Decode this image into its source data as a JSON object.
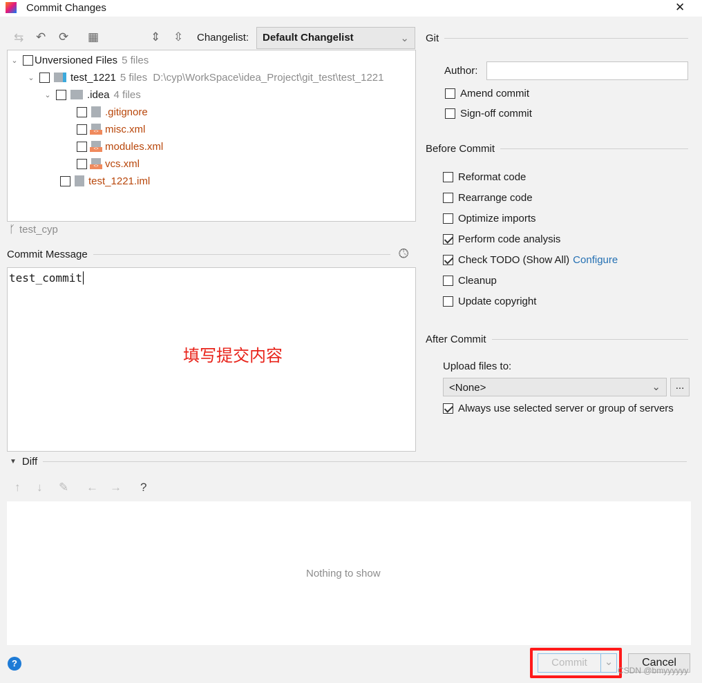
{
  "window": {
    "title": "Commit Changes",
    "close": "✕"
  },
  "toolbar": {
    "changelist_label": "Changelist:",
    "changelist_value": "Default Changelist"
  },
  "tree": [
    {
      "label": "Unversioned Files",
      "meta": "5 files",
      "level": 0,
      "type": "group"
    },
    {
      "label": "test_1221",
      "meta": "5 files  D:\\cyp\\WorkSpace\\idea_Project\\git_test\\test_1221",
      "level": 1,
      "type": "module"
    },
    {
      "label": ".idea",
      "meta": "4 files",
      "level": 2,
      "type": "folder"
    },
    {
      "label": ".gitignore",
      "level": 3,
      "type": "file"
    },
    {
      "label": "misc.xml",
      "level": 3,
      "type": "xml"
    },
    {
      "label": "modules.xml",
      "level": 3,
      "type": "xml"
    },
    {
      "label": "vcs.xml",
      "level": 3,
      "type": "xml"
    },
    {
      "label": "test_1221.iml",
      "level": 2,
      "type": "file"
    }
  ],
  "branch": "test_cyp",
  "commit_message": {
    "label": "Commit Message",
    "value": "test_commit",
    "annotation": "填写提交内容"
  },
  "git": {
    "title": "Git",
    "author_label": "Author:",
    "author_value": "",
    "amend": "Amend commit",
    "signoff": "Sign-off commit"
  },
  "before_commit": {
    "title": "Before Commit",
    "options": [
      {
        "label": "Reformat code",
        "checked": false
      },
      {
        "label": "Rearrange code",
        "checked": false
      },
      {
        "label": "Optimize imports",
        "checked": false
      },
      {
        "label": "Perform code analysis",
        "checked": true
      },
      {
        "label": "Check TODO (Show All)",
        "checked": true,
        "link": "Configure"
      },
      {
        "label": "Cleanup",
        "checked": false
      },
      {
        "label": "Update copyright",
        "checked": false
      }
    ]
  },
  "after_commit": {
    "title": "After Commit",
    "upload_label": "Upload files to:",
    "upload_value": "<None>",
    "browse": "...",
    "always": "Always use selected server or group of servers"
  },
  "diff": {
    "title": "Diff",
    "empty": "Nothing to show"
  },
  "buttons": {
    "commit": "Commit",
    "cancel": "Cancel",
    "help": "?"
  },
  "watermark": "CSDN @bmyyyyyy",
  "colors": {
    "highlight": "#ff1a1a",
    "link": "#2470b3",
    "unversioned": "#b8460a"
  }
}
